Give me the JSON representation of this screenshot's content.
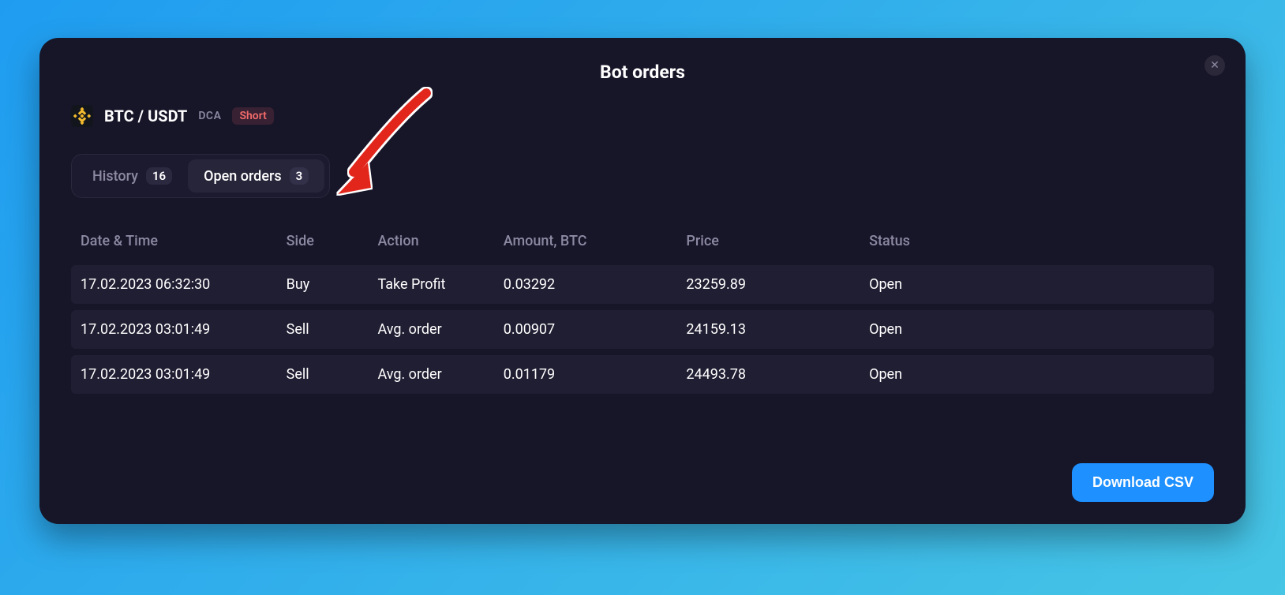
{
  "modal": {
    "title": "Bot orders",
    "close_glyph": "✕"
  },
  "pair": {
    "text": "BTC / USDT",
    "strategy": "DCA",
    "side_badge": "Short"
  },
  "tabs": [
    {
      "label": "History",
      "count": "16",
      "active": false
    },
    {
      "label": "Open orders",
      "count": "3",
      "active": true
    }
  ],
  "table": {
    "headers": {
      "date": "Date & Time",
      "side": "Side",
      "action": "Action",
      "amount": "Amount, BTC",
      "price": "Price",
      "status": "Status"
    },
    "rows": [
      {
        "date": "17.02.2023 06:32:30",
        "side": "Buy",
        "action": "Take Profit",
        "amount": "0.03292",
        "price": "23259.89",
        "status": "Open"
      },
      {
        "date": "17.02.2023 03:01:49",
        "side": "Sell",
        "action": "Avg. order",
        "amount": "0.00907",
        "price": "24159.13",
        "status": "Open"
      },
      {
        "date": "17.02.2023 03:01:49",
        "side": "Sell",
        "action": "Avg. order",
        "amount": "0.01179",
        "price": "24493.78",
        "status": "Open"
      }
    ]
  },
  "footer": {
    "download_label": "Download CSV"
  }
}
